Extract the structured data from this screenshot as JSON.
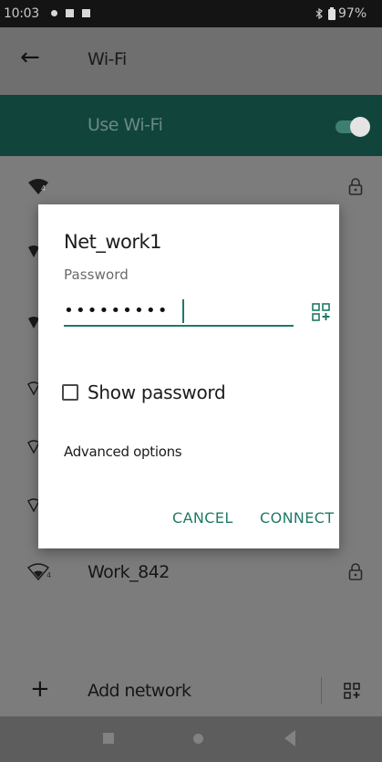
{
  "status_bar": {
    "time": "10:03",
    "battery": "97%"
  },
  "header": {
    "title": "Wi-Fi"
  },
  "use_wifi": {
    "label": "Use Wi-Fi",
    "enabled": true
  },
  "networks": [
    {
      "name": "",
      "secured": true
    },
    {
      "name": "Work_842",
      "secured": true
    }
  ],
  "add_network": {
    "label": "Add network"
  },
  "dialog": {
    "title": "Net_work1",
    "password_label": "Password",
    "password_value": "•••••••••",
    "show_password_label": "Show password",
    "show_password_checked": false,
    "advanced_label": "Advanced options",
    "cancel_label": "CANCEL",
    "connect_label": "CONNECT"
  },
  "colors": {
    "accent": "#1f7a67",
    "scrim_background": "#7c7c7c",
    "switch_bar": "#11443a"
  }
}
